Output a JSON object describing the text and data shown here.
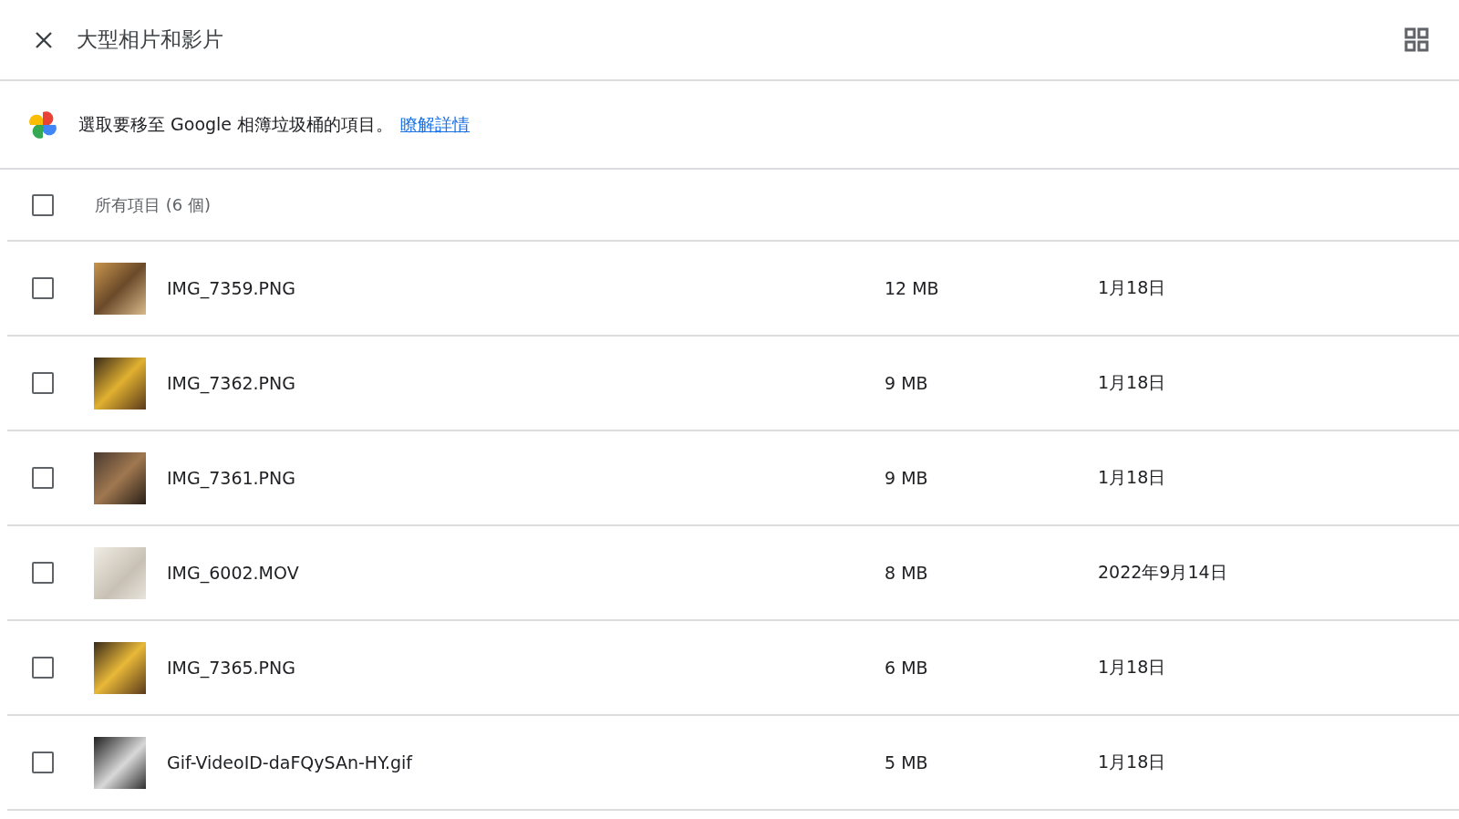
{
  "header": {
    "title": "大型相片和影片"
  },
  "notice": {
    "text": "選取要移至 Google 相簿垃圾桶的項目。",
    "link": "瞭解詳情"
  },
  "select_all": {
    "label": "所有項目 (6 個)",
    "checked": false
  },
  "items": [
    {
      "name": "IMG_7359.PNG",
      "size": "12 MB",
      "date": "1月18日",
      "checked": false
    },
    {
      "name": "IMG_7362.PNG",
      "size": "9 MB",
      "date": "1月18日",
      "checked": false
    },
    {
      "name": "IMG_7361.PNG",
      "size": "9 MB",
      "date": "1月18日",
      "checked": false
    },
    {
      "name": "IMG_6002.MOV",
      "size": "8 MB",
      "date": "2022年9月14日",
      "checked": false
    },
    {
      "name": "IMG_7365.PNG",
      "size": "6 MB",
      "date": "1月18日",
      "checked": false
    },
    {
      "name": "Gif-VideoID-daFQySAn-HY.gif",
      "size": "5 MB",
      "date": "1月18日",
      "checked": false
    }
  ]
}
